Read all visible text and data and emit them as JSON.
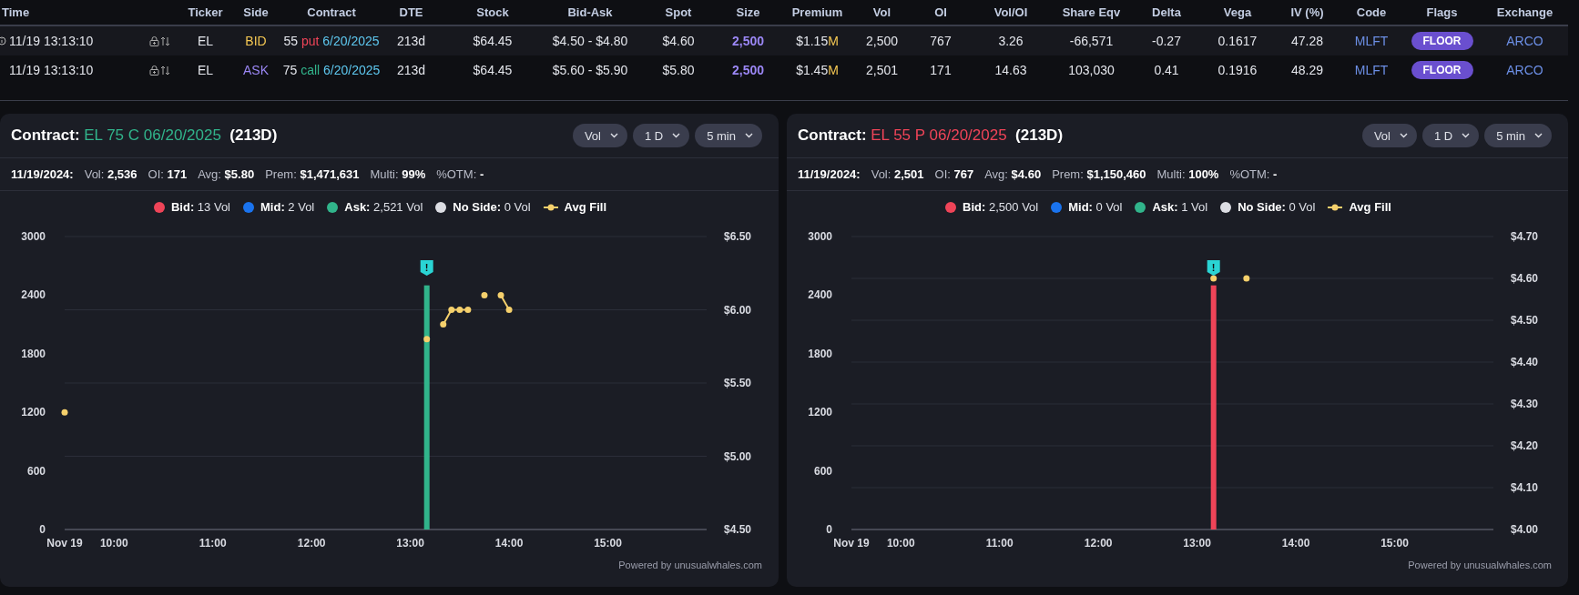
{
  "table": {
    "columns": [
      "Time",
      "Ticker",
      "Side",
      "Contract",
      "DTE",
      "Stock",
      "Bid-Ask",
      "Spot",
      "Size",
      "Premium",
      "Vol",
      "OI",
      "Vol/OI",
      "Share Eqv",
      "Delta",
      "Vega",
      "IV (%)",
      "Code",
      "Flags",
      "Exchange"
    ],
    "rows": [
      {
        "highlighted": true,
        "info_icon": true,
        "time": "11/19 13:13:10",
        "ticker": "EL",
        "side": {
          "label": "BID",
          "kind": "bid"
        },
        "contract": {
          "strike": "55",
          "type": "put",
          "kind": "put",
          "expiry": "6/20/2025"
        },
        "dte": "213d",
        "stock": "$64.45",
        "bid_ask": "$4.50 - $4.80",
        "spot": "$4.60",
        "size": "2,500",
        "premium": {
          "amount": "$1.15",
          "unit": "M"
        },
        "vol": "2,500",
        "oi": "767",
        "vol_oi": "3.26",
        "share_eqv": "-66,571",
        "delta": "-0.27",
        "vega": "0.1617",
        "iv": "47.28",
        "code": "MLFT",
        "flag": "FLOOR",
        "exchange": "ARCO"
      },
      {
        "highlighted": false,
        "info_icon": false,
        "time": "11/19 13:13:10",
        "ticker": "EL",
        "side": {
          "label": "ASK",
          "kind": "ask"
        },
        "contract": {
          "strike": "75",
          "type": "call",
          "kind": "call",
          "expiry": "6/20/2025"
        },
        "dte": "213d",
        "stock": "$64.45",
        "bid_ask": "$5.60 - $5.90",
        "spot": "$5.80",
        "size": "2,500",
        "premium": {
          "amount": "$1.45",
          "unit": "M"
        },
        "vol": "2,501",
        "oi": "171",
        "vol_oi": "14.63",
        "share_eqv": "103,030",
        "delta": "0.41",
        "vega": "0.1916",
        "iv": "48.29",
        "code": "MLFT",
        "flag": "FLOOR",
        "exchange": "ARCO"
      }
    ]
  },
  "panels": [
    {
      "title": {
        "label": "Contract:",
        "contract": "EL 75 C 06/20/2025",
        "kind": "call",
        "dte": "(213D)"
      },
      "dropdowns": [
        "Vol",
        "1 D",
        "5 min"
      ],
      "stats_date": "11/19/2024:",
      "stats": [
        {
          "label": "Vol:",
          "value": "2,536"
        },
        {
          "label": "OI:",
          "value": "171"
        },
        {
          "label": "Avg:",
          "value": "$5.80"
        },
        {
          "label": "Prem:",
          "value": "$1,471,631"
        },
        {
          "label": "Multi:",
          "value": "99%"
        },
        {
          "label": "%OTM:",
          "value": "-"
        }
      ],
      "legend": [
        {
          "kind": "dot",
          "label": "Bid:",
          "value": "13 Vol",
          "color": "#ef4458"
        },
        {
          "kind": "dot",
          "label": "Mid:",
          "value": "2 Vol",
          "color": "#1a73ee"
        },
        {
          "kind": "dot",
          "label": "Ask:",
          "value": "2,521 Vol",
          "color": "#31b48b"
        },
        {
          "kind": "dot",
          "label": "No Side:",
          "value": "0 Vol",
          "color": "#dcdde3"
        },
        {
          "kind": "line",
          "label": "Avg Fill",
          "color": "#f5d06c"
        }
      ],
      "chart_data": {
        "type": "bar",
        "grid": true,
        "x": [
          570,
          790,
          800,
          805,
          810,
          815,
          825,
          835,
          840
        ],
        "xlim": [
          570,
          960
        ],
        "xticks": [
          {
            "value": 570,
            "label": "Nov 19"
          },
          {
            "value": 600,
            "label": "10:00"
          },
          {
            "value": 660,
            "label": "11:00"
          },
          {
            "value": 720,
            "label": "12:00"
          },
          {
            "value": 780,
            "label": "13:00"
          },
          {
            "value": 840,
            "label": "14:00"
          },
          {
            "value": 900,
            "label": "15:00"
          }
        ],
        "ylim": [
          0,
          3000
        ],
        "yticks": [
          0,
          600,
          1200,
          1800,
          2400,
          3000
        ],
        "y2lim": [
          4.5,
          6.5
        ],
        "y2ticks": [
          {
            "value": 4.5,
            "label": "$4.50"
          },
          {
            "value": 5,
            "label": "$5.00"
          },
          {
            "value": 5.5,
            "label": "$5.50"
          },
          {
            "value": 6,
            "label": "$6.00"
          },
          {
            "value": 6.5,
            "label": "$6.50"
          }
        ],
        "series": [
          {
            "color": "#31b48b",
            "values": [
              null,
              2500,
              null,
              null,
              null,
              null,
              null,
              null,
              null
            ]
          },
          {
            "color": "#f5d06c",
            "values": [
              5.3,
              5.8,
              5.9,
              6.0,
              6.0,
              6.0,
              6.1,
              6.1,
              6.0
            ]
          }
        ],
        "annotations": [
          {
            "x": 790,
            "text": "!"
          }
        ]
      },
      "footer": "Powered by unusualwhales.com"
    },
    {
      "title": {
        "label": "Contract:",
        "contract": "EL 55 P 06/20/2025",
        "kind": "put",
        "dte": "(213D)"
      },
      "dropdowns": [
        "Vol",
        "1 D",
        "5 min"
      ],
      "stats_date": "11/19/2024:",
      "stats": [
        {
          "label": "Vol:",
          "value": "2,501"
        },
        {
          "label": "OI:",
          "value": "767"
        },
        {
          "label": "Avg:",
          "value": "$4.60"
        },
        {
          "label": "Prem:",
          "value": "$1,150,460"
        },
        {
          "label": "Multi:",
          "value": "100%"
        },
        {
          "label": "%OTM:",
          "value": "-"
        }
      ],
      "legend": [
        {
          "kind": "dot",
          "label": "Bid:",
          "value": "2,500 Vol",
          "color": "#ef4458"
        },
        {
          "kind": "dot",
          "label": "Mid:",
          "value": "0 Vol",
          "color": "#1a73ee"
        },
        {
          "kind": "dot",
          "label": "Ask:",
          "value": "1 Vol",
          "color": "#31b48b"
        },
        {
          "kind": "dot",
          "label": "No Side:",
          "value": "0 Vol",
          "color": "#dcdde3"
        },
        {
          "kind": "line",
          "label": "Avg Fill",
          "color": "#f5d06c"
        }
      ],
      "chart_data": {
        "type": "bar",
        "grid": true,
        "x": [
          790,
          810
        ],
        "xlim": [
          570,
          960
        ],
        "xticks": [
          {
            "value": 570,
            "label": "Nov 19"
          },
          {
            "value": 600,
            "label": "10:00"
          },
          {
            "value": 660,
            "label": "11:00"
          },
          {
            "value": 720,
            "label": "12:00"
          },
          {
            "value": 780,
            "label": "13:00"
          },
          {
            "value": 840,
            "label": "14:00"
          },
          {
            "value": 900,
            "label": "15:00"
          }
        ],
        "ylim": [
          0,
          3000
        ],
        "yticks": [
          0,
          600,
          1200,
          1800,
          2400,
          3000
        ],
        "y2lim": [
          4.0,
          4.7
        ],
        "y2ticks": [
          {
            "value": 4.0,
            "label": "$4.00"
          },
          {
            "value": 4.1,
            "label": "$4.10"
          },
          {
            "value": 4.2,
            "label": "$4.20"
          },
          {
            "value": 4.3,
            "label": "$4.30"
          },
          {
            "value": 4.4,
            "label": "$4.40"
          },
          {
            "value": 4.5,
            "label": "$4.50"
          },
          {
            "value": 4.6,
            "label": "$4.60"
          },
          {
            "value": 4.7,
            "label": "$4.70"
          }
        ],
        "series": [
          {
            "color": "#ef4458",
            "values": [
              2500,
              null
            ]
          },
          {
            "color": "#f5d06c",
            "values": [
              4.6,
              4.6
            ]
          }
        ],
        "annotations": [
          {
            "x": 790,
            "text": "!"
          }
        ]
      },
      "footer": "Powered by unusualwhales.com"
    }
  ]
}
